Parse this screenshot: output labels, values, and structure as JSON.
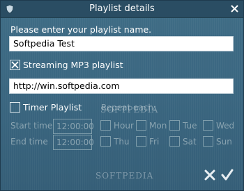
{
  "window": {
    "title": "Playlist details"
  },
  "form": {
    "prompt": "Please enter your playlist name.",
    "playlist_name": "Softpedia Test",
    "streaming_label": "Streaming MP3 playlist",
    "streaming_checked": true,
    "url": "http://win.softpedia.com",
    "timer_label": "Timer Playlist",
    "timer_checked": false,
    "repeat_label": "Repeat each:",
    "start_label": "Start time",
    "start_value": "12:00:00",
    "end_label": "End time",
    "end_value": "12:00:00",
    "days_row1": [
      "Hour",
      "Mon",
      "Tue",
      "Wed"
    ],
    "days_row2": [
      "Thu",
      "Fri",
      "Sat",
      "Sun"
    ]
  },
  "watermark": "SOFTPEDIA",
  "colors": {
    "background": "#3a6680",
    "titlebar": "#2a4d63",
    "disabled_text": "#8aa4b1"
  },
  "icons": {
    "app": "shield-icon",
    "close": "close-icon",
    "cancel": "cross-icon",
    "confirm": "checkmark-icon"
  }
}
